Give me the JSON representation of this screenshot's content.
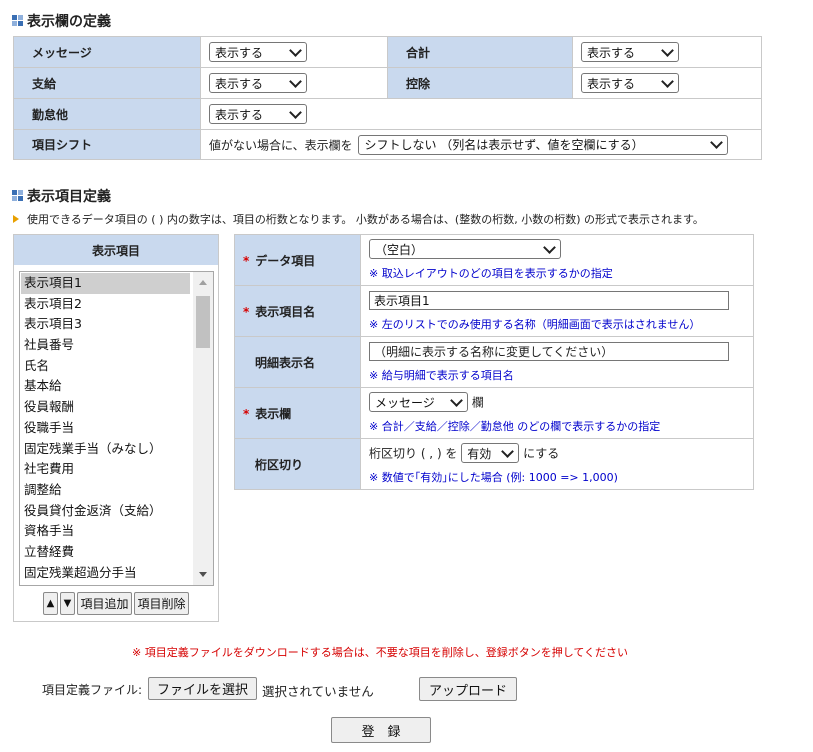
{
  "section1": {
    "title": "表示欄の定義",
    "rows": {
      "message_label": "メッセージ",
      "message_value": "表示する",
      "total_label": "合計",
      "total_value": "表示する",
      "pay_label": "支給",
      "pay_value": "表示する",
      "deduct_label": "控除",
      "deduct_value": "表示する",
      "attendance_label": "勤怠他",
      "attendance_value": "表示する",
      "shift_label": "項目シフト",
      "shift_prefix": "値がない場合に、表示欄を",
      "shift_value": "シフトしない （列名は表示せず、値を空欄にする）"
    }
  },
  "section2": {
    "title": "表示項目定義",
    "info": "使用できるデータ項目の ( ) 内の数字は、項目の桁数となります。 小数がある場合は、(整数の桁数, 小数の桁数) の形式で表示されます。",
    "list_header": "表示項目",
    "list_items": [
      "表示項目1",
      "表示項目2",
      "表示項目3",
      "社員番号",
      "氏名",
      "基本給",
      "役員報酬",
      "役職手当",
      "固定残業手当（みなし）",
      "社宅費用",
      "調整給",
      "役員貸付金返済（支給）",
      "資格手当",
      "立替経費",
      "固定残業超過分手当"
    ],
    "list_buttons": {
      "up": "▲",
      "down": "▼",
      "add": "項目追加",
      "remove": "項目削除"
    },
    "form": {
      "required_mark": "*",
      "data_item_label": "データ項目",
      "data_item_value": "（空白）",
      "data_item_note": "※ 取込レイアウトのどの項目を表示するかの指定",
      "display_name_label": "表示項目名",
      "display_name_value": "表示項目1",
      "display_name_note": "※ 左のリストでのみ使用する名称（明細画面で表示はされません）",
      "detail_name_label": "明細表示名",
      "detail_name_placeholder": "（明細に表示する名称に変更してください）",
      "detail_name_note": "※ 給与明細で表示する項目名",
      "column_label": "表示欄",
      "column_value": "メッセージ",
      "column_suffix": "欄",
      "column_note": "※ 合計／支給／控除／勤怠他 のどの欄で表示するかの指定",
      "separator_label": "桁区切り",
      "separator_prefix": "桁区切り ( , ) を",
      "separator_value": "有効",
      "separator_suffix": "にする",
      "separator_note": "※ 数値で｢有効｣にした場合 (例: 1000  =>  1,000)"
    }
  },
  "footer": {
    "warning": "※ 項目定義ファイルをダウンロードする場合は、不要な項目を削除し、登録ボタンを押してください",
    "file_label": "項目定義ファイル:",
    "choose_file": "ファイルを選択",
    "no_file": "選択されていません",
    "upload": "アップロード",
    "register": "登　録"
  },
  "colors": {
    "label_bg": "#c9d9ee",
    "note_blue": "#0000cc",
    "warning_red": "#d60000"
  }
}
